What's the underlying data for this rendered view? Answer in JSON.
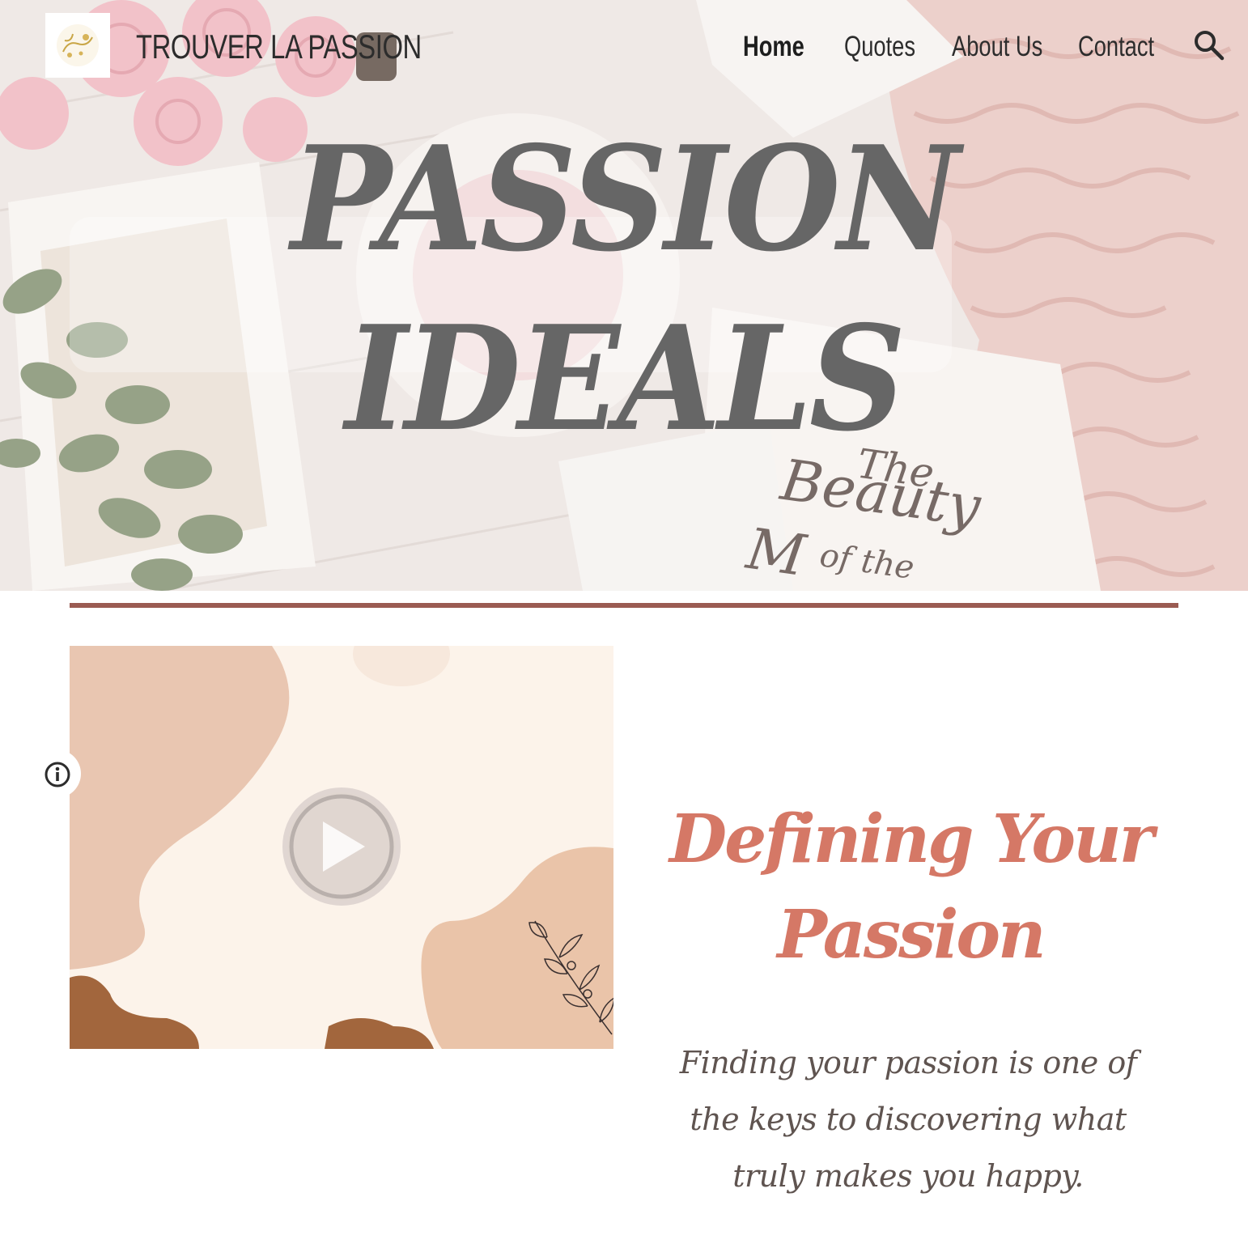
{
  "header": {
    "site_title": "TROUVER LA PASSION",
    "nav": [
      {
        "label": "Home",
        "active": true
      },
      {
        "label": "Quotes",
        "active": false
      },
      {
        "label": "About Us",
        "active": false
      },
      {
        "label": "Contact",
        "active": false
      }
    ],
    "search_icon": "search-icon",
    "logo_icon": "passion-logo"
  },
  "hero": {
    "title_line1": "PASSION",
    "title_line2": "IDEALS",
    "book_text": "The Beauty of the"
  },
  "main": {
    "video": {
      "play_icon": "play-icon",
      "info_icon": "info-icon"
    },
    "heading": "Defining Your Passion",
    "body": "Finding your passion is one of the keys to discovering what truly makes you happy."
  },
  "colors": {
    "accent": "#d57866",
    "divider": "#9a5b52",
    "hero_title": "#666666",
    "text": "#5f5450"
  }
}
